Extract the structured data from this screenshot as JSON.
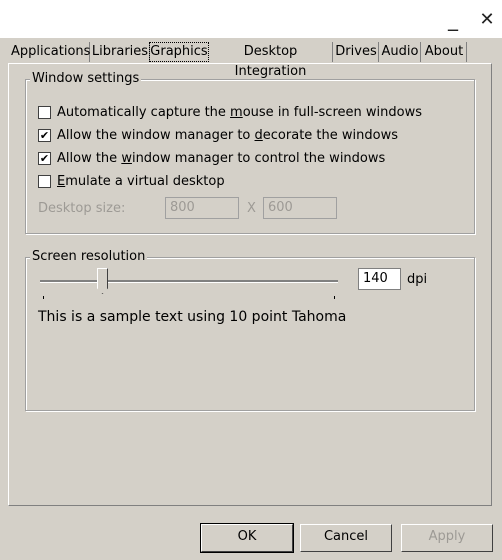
{
  "window": {
    "minimize_glyph": "_",
    "close_glyph": "✕"
  },
  "tabs": [
    {
      "label": "Applications"
    },
    {
      "label": "Libraries"
    },
    {
      "label": "Graphics",
      "active": true
    },
    {
      "label": "Desktop Integration"
    },
    {
      "label": "Drives"
    },
    {
      "label": "Audio"
    },
    {
      "label": "About"
    }
  ],
  "window_settings": {
    "title": "Window settings",
    "options": [
      {
        "pre": "Automatically capture the ",
        "key": "m",
        "post": "ouse in full-screen windows",
        "checked": false
      },
      {
        "pre": "Allow the window manager to ",
        "key": "d",
        "post": "ecorate the windows",
        "checked": true
      },
      {
        "pre": "Allow the ",
        "key": "w",
        "post": "indow manager to control the windows",
        "checked": true
      },
      {
        "pre": "",
        "key": "E",
        "post": "mulate a virtual desktop",
        "checked": false
      }
    ],
    "desktop_size_label": "Desktop size:",
    "desktop_width": "800",
    "size_separator": "X",
    "desktop_height": "600"
  },
  "screen_resolution": {
    "title": "Screen resolution",
    "dpi_value": "140",
    "dpi_unit": "dpi",
    "sample_text": "This is a sample text using 10 point Tahoma",
    "slider_fraction": 0.2
  },
  "buttons": {
    "ok": "OK",
    "cancel": "Cancel",
    "apply": "Apply"
  },
  "icons": {
    "minimize": "minimize-icon",
    "close": "close-icon",
    "check": "checkmark-icon"
  }
}
